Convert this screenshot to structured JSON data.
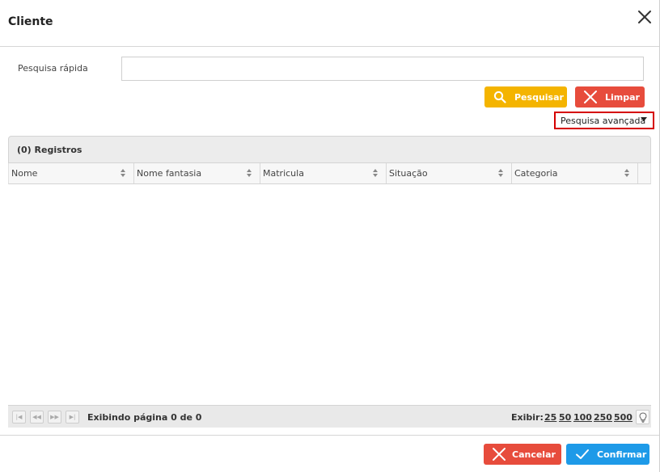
{
  "dialog": {
    "title": "Cliente"
  },
  "search": {
    "label": "Pesquisa rápida",
    "value": "",
    "search_button": "Pesquisar",
    "clear_button": "Limpar",
    "advanced_label": "Pesquisa avançada"
  },
  "grid": {
    "caption": "(0) Registros",
    "columns": [
      "Nome",
      "Nome fantasia",
      "Matricula",
      "Situação",
      "Categoria"
    ]
  },
  "pager": {
    "info": "Exibindo página 0 de 0",
    "show_label": "Exibir:",
    "page_sizes": [
      "25",
      "50",
      "100",
      "250",
      "500"
    ]
  },
  "footer": {
    "cancel_button": "Cancelar",
    "confirm_button": "Confirmar"
  },
  "colors": {
    "search": "#f4b400",
    "clear": "#e74c3c",
    "confirm": "#1e9ae8",
    "highlight": "#d50000"
  },
  "icons": [
    "close-icon",
    "search-icon",
    "x-icon",
    "chevron-down-icon",
    "first-page-icon",
    "prev-page-icon",
    "next-page-icon",
    "last-page-icon",
    "lightbulb-icon",
    "check-icon"
  ]
}
